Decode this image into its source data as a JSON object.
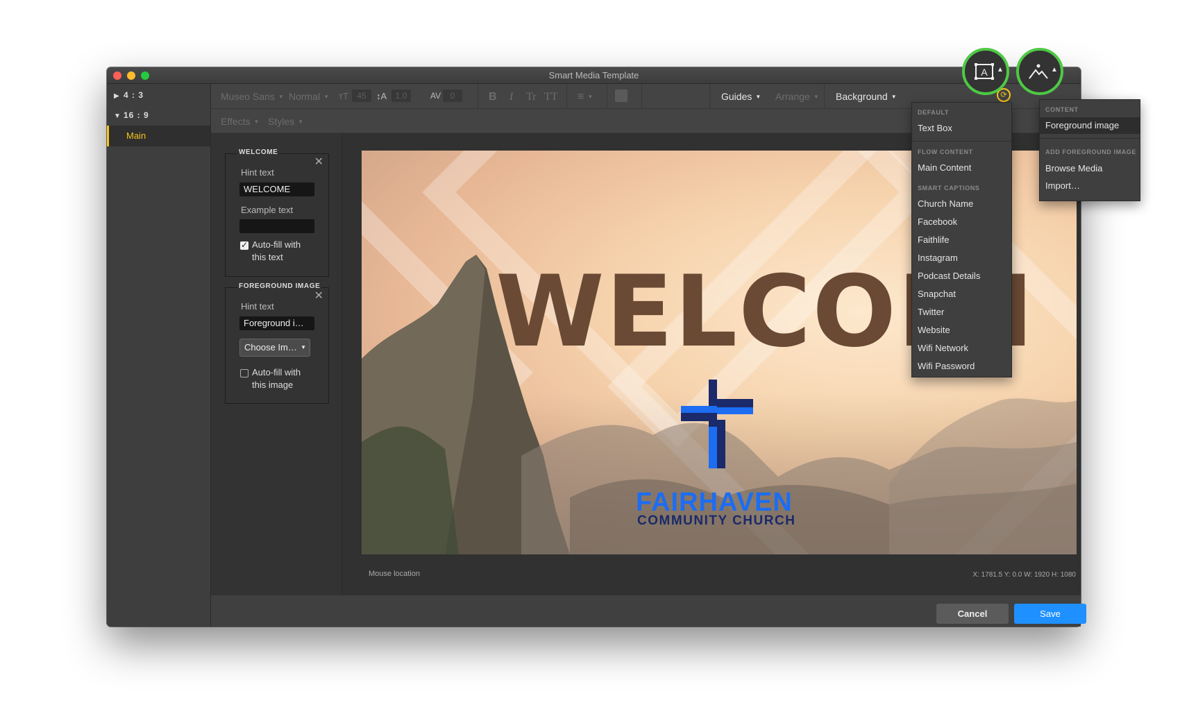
{
  "window": {
    "title": "Smart Media Template"
  },
  "sidebar": {
    "ratios": [
      {
        "label": "4 : 3",
        "expanded": false
      },
      {
        "label": "16 : 9",
        "expanded": true
      }
    ],
    "selected_item": "Main"
  },
  "toolbar": {
    "font": "Museo Sans",
    "weight": "Normal",
    "size": "45",
    "line_height": "1.0",
    "tracking": "0",
    "bold": "B",
    "italic": "I",
    "title_case": "Tr",
    "all_caps": "TT",
    "guides": "Guides",
    "arrange": "Arrange",
    "background": "Background",
    "effects": "Effects",
    "styles": "Styles"
  },
  "panels": {
    "welcome": {
      "title": "WELCOME",
      "hint_label": "Hint text",
      "hint_value": "WELCOME",
      "example_label": "Example text",
      "example_value": "",
      "autofill_label": "Auto-fill with this text",
      "autofill_checked": true
    },
    "foreground": {
      "title": "FOREGROUND IMAGE",
      "hint_label": "Hint text",
      "hint_value": "Foreground i…",
      "choose_label": "Choose Im…",
      "autofill_label": "Auto-fill with this image",
      "autofill_checked": false
    }
  },
  "canvas": {
    "headline": "WELCOMI",
    "church_line1": "FAIRHAVEN",
    "church_line2": "COMMUNITY CHURCH"
  },
  "status": {
    "mouse_location": "Mouse location",
    "coords": "X: 1781.5  Y: 0.0    W: 1920  H: 1080"
  },
  "footer": {
    "cancel": "Cancel",
    "save": "Save"
  },
  "text_menu": {
    "sections": [
      {
        "header": "DEFAULT",
        "items": [
          "Text Box"
        ]
      },
      {
        "header": "FLOW CONTENT",
        "items": [
          "Main Content"
        ]
      },
      {
        "header": "SMART CAPTIONS",
        "items": [
          "Church Name",
          "Facebook",
          "Faithlife",
          "Instagram",
          "Podcast Details",
          "Snapchat",
          "Twitter",
          "Website",
          "Wifi Network",
          "Wifi Password"
        ]
      }
    ]
  },
  "image_menu": {
    "content_header": "CONTENT",
    "content_item": "Foreground image",
    "add_header": "ADD FOREGROUND IMAGE",
    "browse": "Browse Media",
    "import": "Import…"
  },
  "colors": {
    "accent": "#f5c518",
    "highlight_ring": "#4fc945",
    "save_button": "#1e90ff",
    "headline": "#6a4a35",
    "church_blue": "#1c6df2"
  }
}
